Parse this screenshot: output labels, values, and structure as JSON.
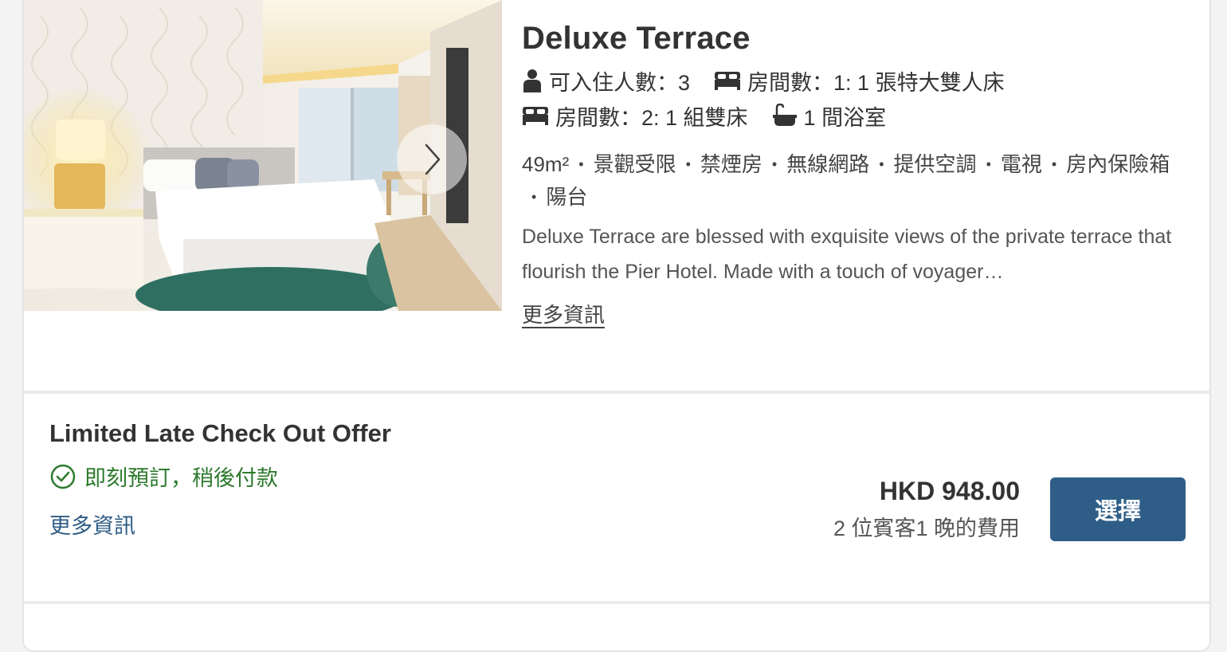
{
  "room": {
    "title": "Deluxe Terrace",
    "specs_row1": [
      {
        "icon": "person-icon",
        "text": "可入住人數：3"
      },
      {
        "icon": "bed-icon",
        "text": "房間數：1: 1 張特大雙人床"
      }
    ],
    "specs_row2": [
      {
        "icon": "bed-icon",
        "text": "房間數：2: 1 組雙床"
      },
      {
        "icon": "bathtub-icon",
        "text": "1 間浴室"
      }
    ],
    "amenities": [
      "49m²",
      "景觀受限",
      "禁煙房",
      "無線網路",
      "提供空調",
      "電視",
      "房內保險箱",
      "陽台"
    ],
    "description": "Deluxe Terrace are blessed with exquisite views of the private terrace that flourish the Pier Hotel. Made with a touch of voyager…",
    "more_info_label": "更多資訊"
  },
  "offer": {
    "title": "Limited Late Check Out Offer",
    "tag": "即刻預訂，稍後付款",
    "more_info_label": "更多資訊",
    "price": "HKD 948.00",
    "price_note": "2 位賓客1 晚的費用",
    "select_label": "選擇"
  },
  "colors": {
    "accent_button": "#2e5e87",
    "link": "#2f5c86",
    "tag_green": "#2d7a2d"
  }
}
